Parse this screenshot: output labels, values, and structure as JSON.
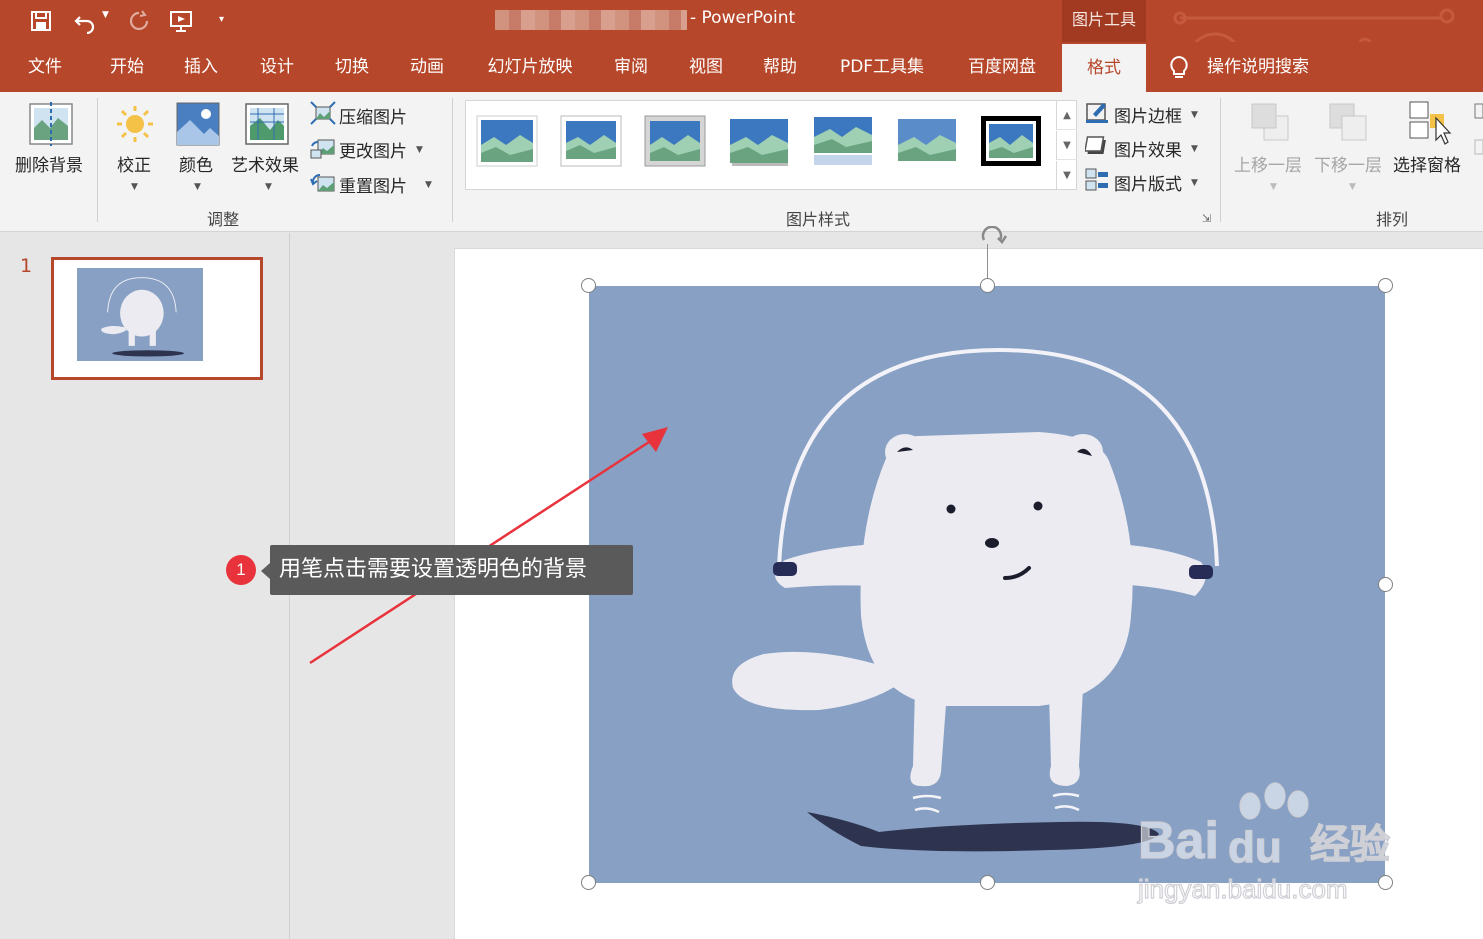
{
  "qat": {
    "save_icon": "save-icon",
    "undo_icon": "undo-icon",
    "redo_icon": "redo-icon",
    "present_icon": "start-presentation-icon",
    "customize_icon": "customize-qat-icon"
  },
  "title": {
    "app_title": "- PowerPoint",
    "context_tab_label": "图片工具"
  },
  "tabs": [
    {
      "label": "文件"
    },
    {
      "label": "开始"
    },
    {
      "label": "插入"
    },
    {
      "label": "设计"
    },
    {
      "label": "切换"
    },
    {
      "label": "动画"
    },
    {
      "label": "幻灯片放映"
    },
    {
      "label": "审阅"
    },
    {
      "label": "视图"
    },
    {
      "label": "帮助"
    },
    {
      "label": "PDF工具集"
    },
    {
      "label": "百度网盘"
    },
    {
      "label": "格式",
      "active": true
    }
  ],
  "tell_me": {
    "label": "操作说明搜索",
    "icon": "lightbulb-icon"
  },
  "ribbon": {
    "adjust": {
      "remove_bg": "删除背景",
      "corrections": "校正",
      "color": "颜色",
      "artistic": "艺术效果",
      "compress": "压缩图片",
      "change": "更改图片",
      "reset": "重置图片",
      "group_label": "调整"
    },
    "styles": {
      "border": "图片边框",
      "effects": "图片效果",
      "layout": "图片版式",
      "group_label": "图片样式"
    },
    "arrange": {
      "bring_forward": "上移一层",
      "send_backward": "下移一层",
      "selection_pane": "选择窗格",
      "group_label": "排列"
    }
  },
  "thumbnails": {
    "slide_number": "1"
  },
  "annotation": {
    "step": "1",
    "tip": "用笔点击需要设置透明色的背景",
    "arrow_color": "#e8333c"
  },
  "watermark": {
    "brand": "Bai",
    "brand_du": "du",
    "brand_cn": "经验",
    "url": "jingyan.baidu.com"
  },
  "colors": {
    "accent": "#b7472a",
    "picture_bg": "#87a0c3",
    "shadow": "#2e3350"
  }
}
